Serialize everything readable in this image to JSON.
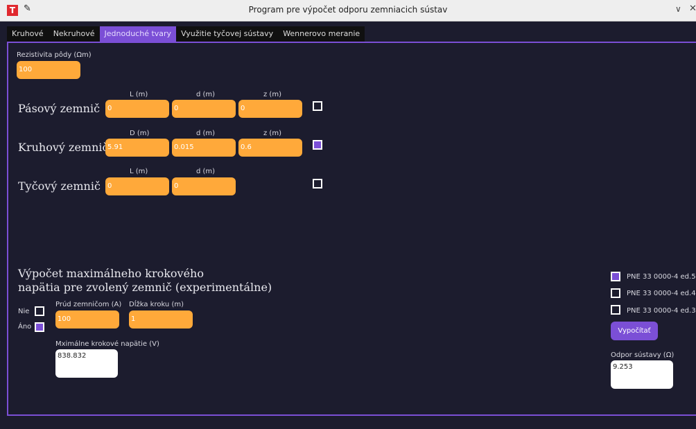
{
  "window": {
    "title": "Program pre výpočet odporu zemniacich sústav",
    "icon_glyph": "T",
    "pin_glyph": "✎",
    "min_glyph": "∨",
    "close_glyph": "✕"
  },
  "tabs": [
    {
      "label": "Kruhové",
      "active": false
    },
    {
      "label": "Nekruhové",
      "active": false
    },
    {
      "label": "Jednoduché tvary",
      "active": true
    },
    {
      "label": "Využitie tyčovej sústavy",
      "active": false
    },
    {
      "label": "Wennerovo meranie",
      "active": false
    }
  ],
  "resistivity": {
    "label": "Rezistivita pôdy (Ωm)",
    "value": "100"
  },
  "strip": {
    "name": "Pásový zemnič",
    "labels": [
      "L (m)",
      "d (m)",
      "z (m)"
    ],
    "values": [
      "0",
      "0",
      "0"
    ],
    "checked": false
  },
  "ring": {
    "name": "Kruhový zemnič",
    "labels": [
      "D (m)",
      "d (m)",
      "z (m)"
    ],
    "values": [
      "5.91",
      "0.015",
      "0.6"
    ],
    "checked": true
  },
  "rod": {
    "name": "Tyčový zemnič",
    "labels": [
      "L (m)",
      "d (m)"
    ],
    "values": [
      "0",
      "0"
    ],
    "checked": false
  },
  "step": {
    "heading_line1": "Výpočet maximálneho krokového",
    "heading_line2": "napätia pre zvolený zemnič (experimentálne)",
    "no_label": "Nie",
    "yes_label": "Áno",
    "no_checked": false,
    "yes_checked": true,
    "current_label": "Prúd zemničom (A)",
    "current_value": "100",
    "step_label": "Dĺžka kroku (m)",
    "step_value": "1",
    "max_label": "Mximálne krokové napätie (V)",
    "max_value": "838.832"
  },
  "standards": [
    {
      "label": "PNE 33 0000-4 ed.5",
      "checked": true
    },
    {
      "label": "PNE 33 0000-4 ed.4",
      "checked": false
    },
    {
      "label": "PNE 33 0000-4 ed.3",
      "checked": false
    }
  ],
  "calc_button": "Vypočítať",
  "result": {
    "label": "Odpor sústavy (Ω)",
    "value": "9.253"
  },
  "colors": {
    "accent": "#7b4fd6",
    "input": "#ffa93a",
    "background": "#1c1c2e"
  }
}
